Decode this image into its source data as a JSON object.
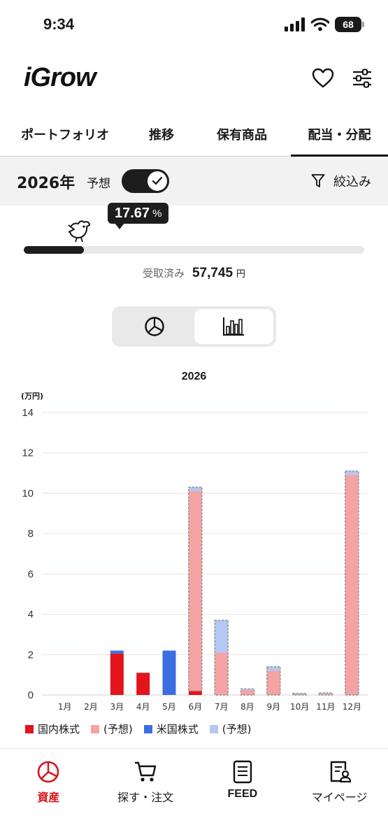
{
  "status_bar": {
    "time": "9:34",
    "battery": "68"
  },
  "header": {
    "logo": "iGrow",
    "favorite_icon": "heart-icon",
    "settings_icon": "sliders-icon"
  },
  "tabs": [
    {
      "label": "ポートフォリオ",
      "active": false
    },
    {
      "label": "推移",
      "active": false
    },
    {
      "label": "保有商品",
      "active": false
    },
    {
      "label": "配当・分配",
      "active": true
    }
  ],
  "filter_bar": {
    "year": "2026年",
    "forecast_label": "予想",
    "forecast_toggle_on": true,
    "filter_label": "絞込み"
  },
  "progress": {
    "percent_value": "17.67",
    "percent_sign": "%",
    "fill_fraction": 0.1767,
    "received_label": "受取済み",
    "received_amount": "57,745",
    "received_unit": "円"
  },
  "view_toggle": {
    "options": [
      "pie-chart-icon",
      "bar-chart-icon"
    ],
    "active": "bar-chart-icon"
  },
  "chart_data": {
    "type": "bar",
    "title": "2026",
    "ylabel": "(万円)",
    "ylim": [
      0,
      14
    ],
    "yticks": [
      0,
      2,
      4,
      6,
      8,
      10,
      12,
      14
    ],
    "categories": [
      "1月",
      "2月",
      "3月",
      "4月",
      "5月",
      "6月",
      "7月",
      "8月",
      "9月",
      "10月",
      "11月",
      "12月"
    ],
    "stacked": true,
    "series": [
      {
        "name": "国内株式",
        "color": "#e3141c",
        "values": [
          0,
          0,
          2.05,
          1.1,
          0,
          0.2,
          0,
          0,
          0,
          0,
          0,
          0
        ]
      },
      {
        "name": "(予想)",
        "color": "#f5a3a3",
        "forecast": true,
        "values": [
          0,
          0,
          0,
          0,
          0,
          9.9,
          2.1,
          0.25,
          1.2,
          0.03,
          0.05,
          10.9
        ]
      },
      {
        "name": "米国株式",
        "color": "#3b6fe0",
        "values": [
          0,
          0,
          0.15,
          0,
          2.2,
          0,
          0,
          0,
          0,
          0,
          0,
          0
        ]
      },
      {
        "name": "(予想)",
        "color": "#b4c8f4",
        "forecast": true,
        "values": [
          0,
          0,
          0,
          0,
          0,
          0.2,
          1.6,
          0.05,
          0.2,
          0.05,
          0.05,
          0.2
        ]
      }
    ],
    "grid": true,
    "legend": "bottom"
  },
  "bottom_nav": [
    {
      "label": "資産",
      "icon": "pie-chart-icon",
      "active": true
    },
    {
      "label": "探す・注文",
      "icon": "cart-icon",
      "active": false
    },
    {
      "label": "FEED",
      "icon": "document-icon",
      "active": false
    },
    {
      "label": "マイページ",
      "icon": "profile-icon",
      "active": false
    }
  ]
}
